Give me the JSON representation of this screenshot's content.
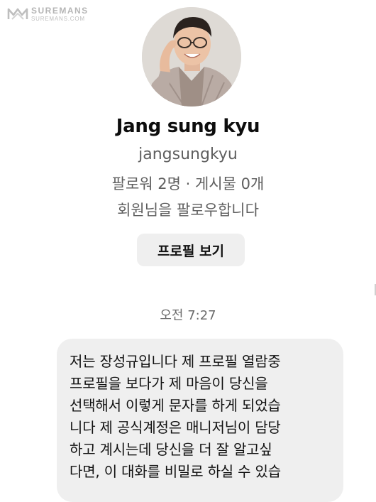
{
  "watermark": {
    "name": "SUREMANS",
    "url": "SUREMANS.COM"
  },
  "profile": {
    "display_name": "Jang sung kyu",
    "username": "jangsungkyu",
    "stats": "팔로워 2명 · 게시물 0개",
    "follow_status": "회원님을 팔로우합니다",
    "view_profile_label": "프로필 보기"
  },
  "conversation": {
    "timestamp": "오전 7:27",
    "message_lines": [
      "저는 장성규입니다 제 프로필 열람중",
      "프로필을 보다가 제 마음이 당신을",
      "선택해서 이렇게 문자를 하게 되었습",
      "니다 제 공식계정은 매니저님이 담당",
      "하고 계시는데 당신을 더 잘 알고싶",
      "다면, 이 대화를 비밀로 하실 수 있습"
    ]
  }
}
